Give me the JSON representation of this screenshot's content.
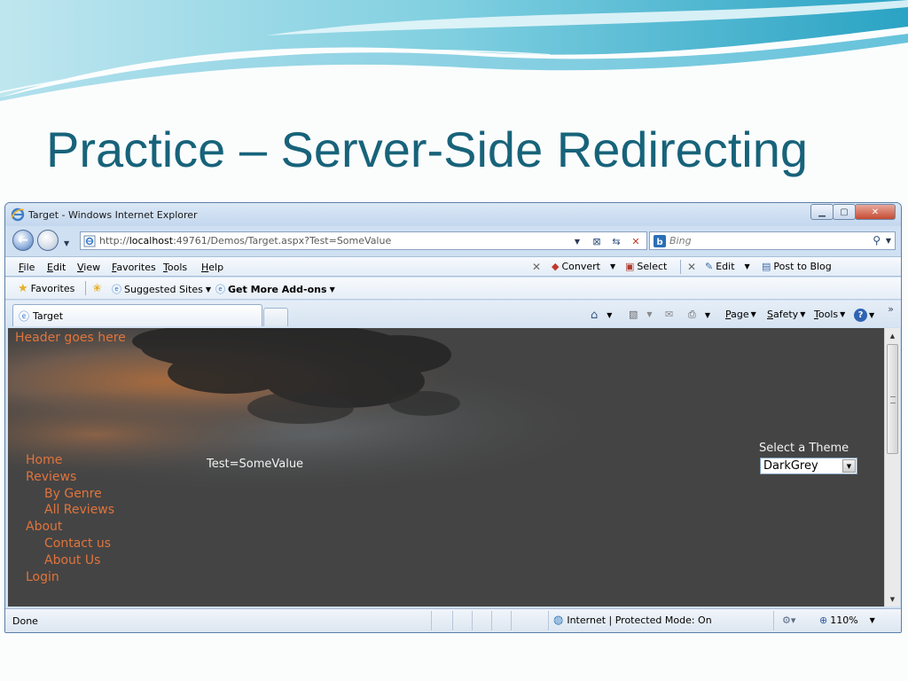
{
  "slide": {
    "title": "Practice – Server-Side Redirecting"
  },
  "window": {
    "title": "Target - Windows Internet Explorer",
    "controls": [
      "minimize",
      "maximize",
      "close"
    ]
  },
  "address": {
    "url_prefix": "http://",
    "url_host": "localhost",
    "url_rest": ":49761/Demos/Target.aspx?Test=SomeValue"
  },
  "search": {
    "placeholder": "Bing"
  },
  "menu": {
    "items": [
      "File",
      "Edit",
      "View",
      "Favorites",
      "Tools",
      "Help"
    ]
  },
  "toolbar": {
    "convert_label": "Convert",
    "select_label": "Select",
    "edit_label": "Edit",
    "post_label": "Post to Blog"
  },
  "favorites": {
    "favorites_label": "Favorites",
    "suggested_label": "Suggested Sites",
    "addons_label": "Get More Add-ons"
  },
  "tabs": {
    "active_label": "Target"
  },
  "commandbar": {
    "page_label": "Page",
    "safety_label": "Safety",
    "tools_label": "Tools"
  },
  "page": {
    "header_text": "Header goes here",
    "query_text": "Test=SomeValue",
    "nav": [
      {
        "label": "Home",
        "level": 0
      },
      {
        "label": "Reviews",
        "level": 0
      },
      {
        "label": "By Genre",
        "level": 1
      },
      {
        "label": "All Reviews",
        "level": 1
      },
      {
        "label": "About",
        "level": 0
      },
      {
        "label": "Contact us",
        "level": 1
      },
      {
        "label": "About Us",
        "level": 1
      },
      {
        "label": "Login",
        "level": 0
      }
    ],
    "theme_label": "Select a Theme",
    "theme_value": "DarkGrey"
  },
  "status": {
    "text": "Done",
    "zone": "Internet | Protected Mode: On",
    "zoom": "110%"
  },
  "colors": {
    "slide_title": "#17637a",
    "content_bg": "#444444",
    "link": "#e0743c"
  }
}
